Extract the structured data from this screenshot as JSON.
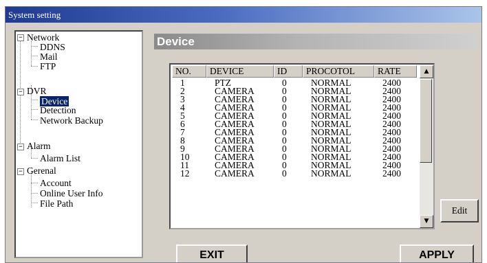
{
  "window": {
    "title": "System setting"
  },
  "tree": {
    "nodes": [
      {
        "label": "Network",
        "expander": "−"
      },
      {
        "label": "DDNS"
      },
      {
        "label": "Mail"
      },
      {
        "label": "FTP"
      },
      {
        "label": "DVR",
        "expander": "−"
      },
      {
        "label": "Device",
        "selected": true
      },
      {
        "label": "Detection"
      },
      {
        "label": "Network Backup"
      },
      {
        "label": "Alarm",
        "expander": "−"
      },
      {
        "label": "Alarm List"
      },
      {
        "label": "Gerenal",
        "expander": "−"
      },
      {
        "label": "Account"
      },
      {
        "label": "Online User Info"
      },
      {
        "label": "File Path"
      }
    ]
  },
  "panel": {
    "title": "Device"
  },
  "table": {
    "columns": [
      "NO.",
      "DEVICE",
      "ID",
      "PROCOTOL",
      "RATE"
    ],
    "rows": [
      [
        "1",
        "PTZ",
        "0",
        "NORMAL",
        "2400"
      ],
      [
        "2",
        "CAMERA",
        "0",
        "NORMAL",
        "2400"
      ],
      [
        "3",
        "CAMERA",
        "0",
        "NORMAL",
        "2400"
      ],
      [
        "4",
        "CAMERA",
        "0",
        "NORMAL",
        "2400"
      ],
      [
        "5",
        "CAMERA",
        "0",
        "NORMAL",
        "2400"
      ],
      [
        "6",
        "CAMERA",
        "0",
        "NORMAL",
        "2400"
      ],
      [
        "7",
        "CAMERA",
        "0",
        "NORMAL",
        "2400"
      ],
      [
        "8",
        "CAMERA",
        "0",
        "NORMAL",
        "2400"
      ],
      [
        "9",
        "CAMERA",
        "0",
        "NORMAL",
        "2400"
      ],
      [
        "10",
        "CAMERA",
        "0",
        "NORMAL",
        "2400"
      ],
      [
        "11",
        "CAMERA",
        "0",
        "NORMAL",
        "2400"
      ],
      [
        "12",
        "CAMERA",
        "0",
        "NORMAL",
        "2400"
      ]
    ],
    "scroll_up_glyph": "▲",
    "scroll_down_glyph": "▼"
  },
  "buttons": {
    "edit": "Edit",
    "exit": "EXIT",
    "apply": "APPLY"
  },
  "colors": {
    "title_bar": "#1f3a92",
    "selection": "#0a246a",
    "panel_header": "#8a8a8a"
  }
}
